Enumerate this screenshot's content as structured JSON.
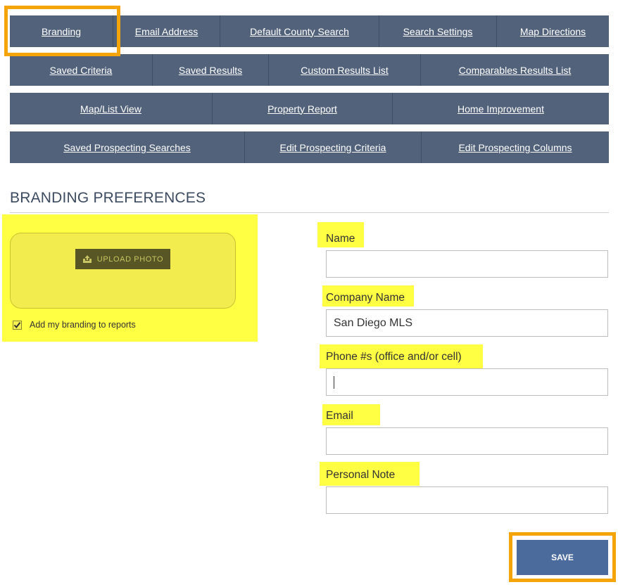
{
  "nav": {
    "row1": [
      "Branding",
      "Email Address",
      "Default County Search",
      "Search Settings",
      "Map Directions"
    ],
    "row2": [
      "Saved Criteria",
      "Saved Results",
      "Custom Results List",
      "Comparables Results List"
    ],
    "row3": [
      "Map/List View",
      "Property Report",
      "Home Improvement"
    ],
    "row4": [
      "Saved Prospecting Searches",
      "Edit Prospecting Criteria",
      "Edit Prospecting Columns"
    ],
    "active": "Branding"
  },
  "section_title": "BRANDING PREFERENCES",
  "upload": {
    "button_label": "UPLOAD PHOTO",
    "checkbox_label": "Add my branding to reports",
    "checkbox_checked": true
  },
  "form": {
    "name": {
      "label": "Name",
      "value": ""
    },
    "company": {
      "label": "Company Name",
      "value": "San Diego MLS"
    },
    "phone": {
      "label": "Phone #s (office and/or cell)",
      "value": ""
    },
    "email": {
      "label": "Email",
      "value": ""
    },
    "note": {
      "label": "Personal Note",
      "value": ""
    }
  },
  "save_label": "SAVE",
  "colors": {
    "nav_bg": "#52627a",
    "highlight_yellow": "#ffff44",
    "highlight_orange": "#f5a50a",
    "save_bg": "#4a6b9b"
  },
  "icons": {
    "upload": "upload-tray-icon",
    "check": "checkmark-icon"
  }
}
